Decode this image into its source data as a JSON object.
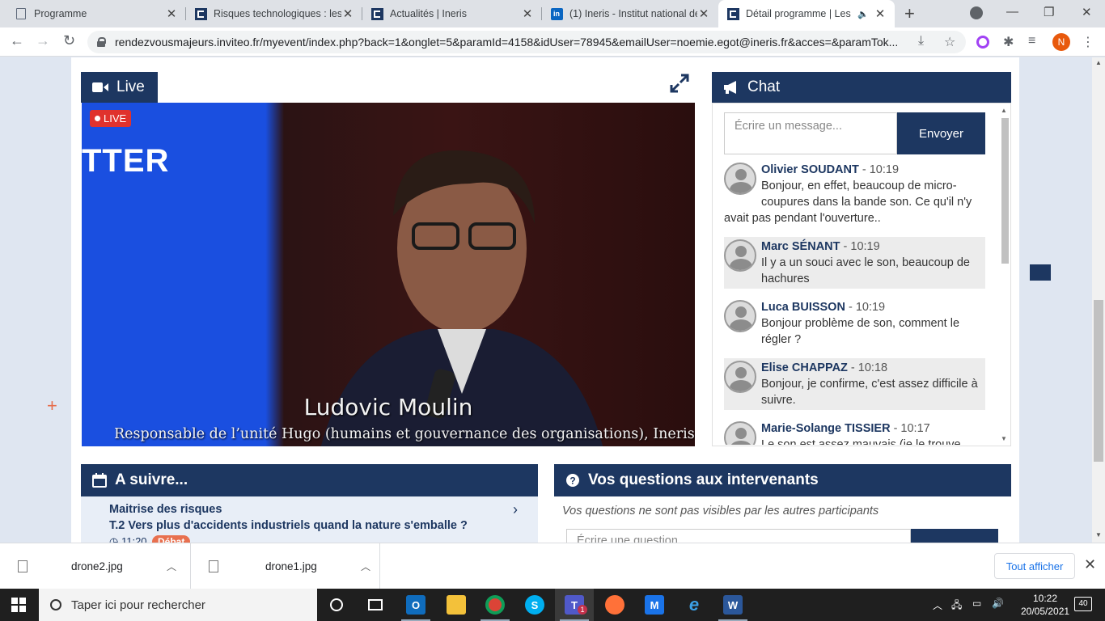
{
  "browser": {
    "tabs": [
      {
        "title": "Programme",
        "icon": "document-icon"
      },
      {
        "title": "Risques technologiques : les r",
        "icon": "ineris-icon"
      },
      {
        "title": "Actualités | Ineris",
        "icon": "ineris-icon"
      },
      {
        "title": "(1) Ineris - Institut national de",
        "icon": "linkedin-icon"
      },
      {
        "title": "Détail programme | Les n",
        "icon": "ineris-icon",
        "active": true,
        "audio": true
      }
    ],
    "url": "rendezvousmajeurs.inviteo.fr/myevent/index.php?back=1&onglet=5&paramId=4158&idUser=78945&emailUser=noemie.egot@ineris.fr&acces=&paramTok...",
    "profile_initial": "N"
  },
  "live": {
    "tab_label": "Live",
    "badge": "LIVE",
    "background_word": "TTER",
    "speaker_name": "Ludovic Moulin",
    "speaker_role": "Responsable de l’unité Hugo (humains et gouvernance des organisations), Ineris"
  },
  "chat": {
    "title": "Chat",
    "placeholder": "Écrire un message...",
    "send_label": "Envoyer",
    "messages": [
      {
        "author": "Olivier SOUDANT",
        "time": " - 10:19",
        "text": "Bonjour, en effet, beaucoup de micro-coupures dans la bande son. Ce qu'il n'y avait pas pendant l'ouverture.."
      },
      {
        "author": "Marc SÉNANT",
        "time": " - 10:19",
        "text": "Il y a un souci avec le son, beaucoup de hachures"
      },
      {
        "author": "Luca BUISSON",
        "time": " - 10:19",
        "text": "Bonjour problème de son, comment le régler ?"
      },
      {
        "author": "Elise CHAPPAZ",
        "time": " - 10:18",
        "text": "Bonjour, je confirme, c'est assez difficile à suivre."
      },
      {
        "author": "Marie-Solange TISSIER",
        "time": " - 10:17",
        "text": "Le son est assez mauvais (je le trouve"
      }
    ]
  },
  "next": {
    "title": "A suivre...",
    "item_category": "Maitrise des risques",
    "item_title": "T.2 Vers plus d'accidents industriels quand la nature s'emballe ?",
    "item_time": "11:20",
    "item_badge": "Débat"
  },
  "questions": {
    "title": "Vos questions aux intervenants",
    "note": "Vos questions ne sont pas visibles par les autres participants",
    "placeholder": "Écrire une question..."
  },
  "downloads": {
    "items": [
      "drone2.jpg",
      "drone1.jpg"
    ],
    "show_all": "Tout afficher"
  },
  "taskbar": {
    "search_placeholder": "Taper ici pour rechercher",
    "time": "10:22",
    "date": "20/05/2021",
    "notification_count": "40",
    "teams_badge": "1"
  },
  "colors": {
    "navy": "#1d3761",
    "live_red": "#e0322d",
    "badge_orange": "#e8704f",
    "link_blue": "#1a73e8"
  }
}
